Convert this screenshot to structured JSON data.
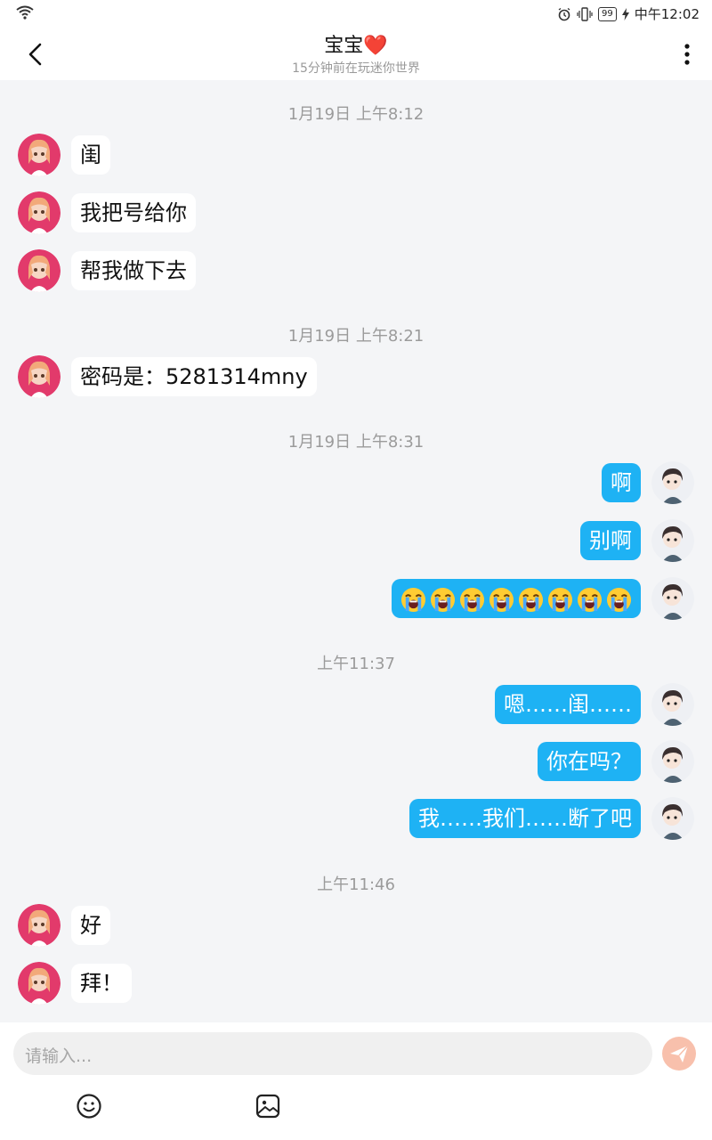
{
  "status_bar": {
    "time": "中午12:02",
    "battery": "99",
    "icons": [
      "wifi-icon",
      "alarm-icon",
      "vibrate-icon",
      "battery-icon",
      "charging-icon"
    ]
  },
  "header": {
    "title": "宝宝",
    "title_emoji": "❤️",
    "subtitle": "15分钟前在玩迷你世界"
  },
  "timestamps": [
    "1月19日 上午8:12",
    "1月19日 上午8:21",
    "1月19日 上午8:31",
    "上午11:37",
    "上午11:46"
  ],
  "messages": [
    {
      "side": "left",
      "text": "闺"
    },
    {
      "side": "left",
      "text": "我把号给你"
    },
    {
      "side": "left",
      "text": "帮我做下去"
    },
    {
      "side": "left",
      "text": "密码是：5281314mny"
    },
    {
      "side": "right",
      "text": "啊"
    },
    {
      "side": "right",
      "text": "别啊"
    },
    {
      "side": "right",
      "text": "",
      "emoji": "loudly-crying-face",
      "emoji_count": 8
    },
    {
      "side": "right",
      "text": "嗯……闺……"
    },
    {
      "side": "right",
      "text": "你在吗？"
    },
    {
      "side": "right",
      "text": "我……我们……断了吧"
    },
    {
      "side": "left",
      "text": "好"
    },
    {
      "side": "left",
      "text": "拜！"
    }
  ],
  "composer": {
    "placeholder": "请输入...",
    "tools": [
      "smiley-icon",
      "image-icon"
    ],
    "send_icon": "send-icon"
  },
  "colors": {
    "accent_bubble": "#1eb2f4",
    "background": "#f4f5f7",
    "send_button": "#f8c0ac",
    "heart": "#e02b2b"
  }
}
